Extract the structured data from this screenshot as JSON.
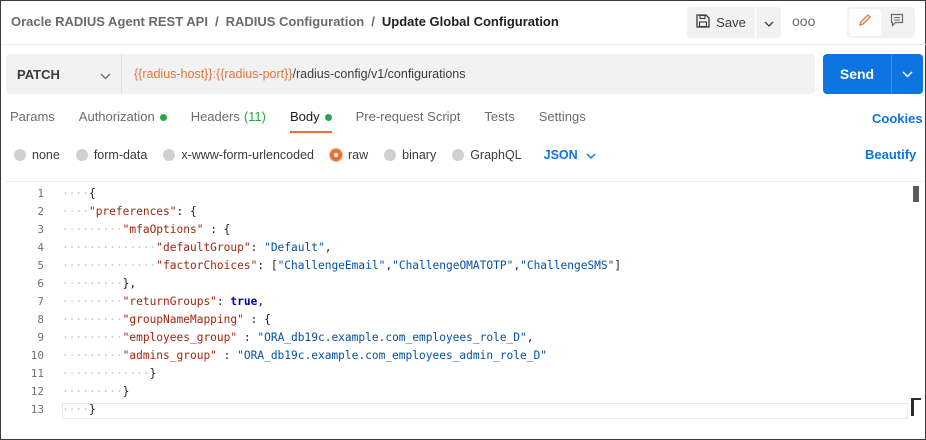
{
  "header": {
    "breadcrumbs": [
      "Oracle RADIUS Agent REST API",
      "RADIUS Configuration"
    ],
    "separator": "/",
    "current": "Update Global Configuration",
    "save_label": "Save",
    "more_label": "ooo"
  },
  "request": {
    "method": "PATCH",
    "url_vars": [
      "{{radius-host}}",
      ":",
      "{{radius-port}}"
    ],
    "url_path": "/radius-config/v1/configurations",
    "send_label": "Send"
  },
  "tabs": [
    {
      "label": "Params"
    },
    {
      "label": "Authorization",
      "dot": true
    },
    {
      "label": "Headers",
      "count": "(11)"
    },
    {
      "label": "Body",
      "dot": true,
      "active": true
    },
    {
      "label": "Pre-request Script"
    },
    {
      "label": "Tests"
    },
    {
      "label": "Settings"
    }
  ],
  "cookies_label": "Cookies",
  "body_types": [
    {
      "label": "none"
    },
    {
      "label": "form-data"
    },
    {
      "label": "x-www-form-urlencoded"
    },
    {
      "label": "raw",
      "checked": true
    },
    {
      "label": "binary"
    },
    {
      "label": "GraphQL"
    }
  ],
  "language": "JSON",
  "beautify_label": "Beautify",
  "colors": {
    "accent": "#e87236",
    "primary": "#0d74e0",
    "status_dot": "#28a745",
    "url_var": "#e0763b"
  },
  "editor": {
    "line_numbers": [
      "1",
      "2",
      "3",
      "4",
      "5",
      "6",
      "7",
      "8",
      "9",
      "10",
      "11",
      "12",
      "13"
    ],
    "lines": [
      {
        "guide": "····",
        "parts": [
          [
            "p",
            "{"
          ]
        ]
      },
      {
        "guide": "····",
        "parts": [
          [
            "k",
            "\"preferences\""
          ],
          [
            "p",
            ": {"
          ]
        ]
      },
      {
        "guide": "·········",
        "parts": [
          [
            "k",
            "\"mfaOptions\""
          ],
          [
            "p",
            " : {"
          ]
        ]
      },
      {
        "guide": "··············",
        "parts": [
          [
            "k",
            "\"defaultGroup\""
          ],
          [
            "p",
            ": "
          ],
          [
            "s",
            "\"Default\""
          ],
          [
            "p",
            ","
          ]
        ]
      },
      {
        "guide": "··············",
        "parts": [
          [
            "k",
            "\"factorChoices\""
          ],
          [
            "p",
            ": ["
          ],
          [
            "s",
            "\"ChallengeEmail\""
          ],
          [
            "p",
            ","
          ],
          [
            "s",
            "\"ChallengeOMATOTP\""
          ],
          [
            "p",
            ","
          ],
          [
            "s",
            "\"ChallengeSMS\""
          ],
          [
            "p",
            "]"
          ]
        ]
      },
      {
        "guide": "·········",
        "parts": [
          [
            "p",
            "},"
          ]
        ]
      },
      {
        "guide": "·········",
        "parts": [
          [
            "k",
            "\"returnGroups\""
          ],
          [
            "p",
            ": "
          ],
          [
            "kw",
            "true"
          ],
          [
            "p",
            ","
          ]
        ]
      },
      {
        "guide": "·········",
        "parts": [
          [
            "k",
            "\"groupNameMapping\""
          ],
          [
            "p",
            " : {"
          ]
        ]
      },
      {
        "guide": "·········",
        "parts": [
          [
            "k",
            "\"employees_group\""
          ],
          [
            "p",
            " : "
          ],
          [
            "s",
            "\"ORA_db19c.example.com_employees_role_D\""
          ],
          [
            "p",
            ","
          ]
        ]
      },
      {
        "guide": "·········",
        "parts": [
          [
            "k",
            "\"admins_group\""
          ],
          [
            "p",
            " : "
          ],
          [
            "s",
            "\"ORA_db19c.example.com_employees_admin_role_D\""
          ]
        ]
      },
      {
        "guide": "·············",
        "parts": [
          [
            "p",
            "}"
          ]
        ]
      },
      {
        "guide": "·········",
        "parts": [
          [
            "p",
            "}"
          ]
        ]
      },
      {
        "guide": "····",
        "parts": [
          [
            "p",
            "}"
          ]
        ]
      }
    ]
  }
}
